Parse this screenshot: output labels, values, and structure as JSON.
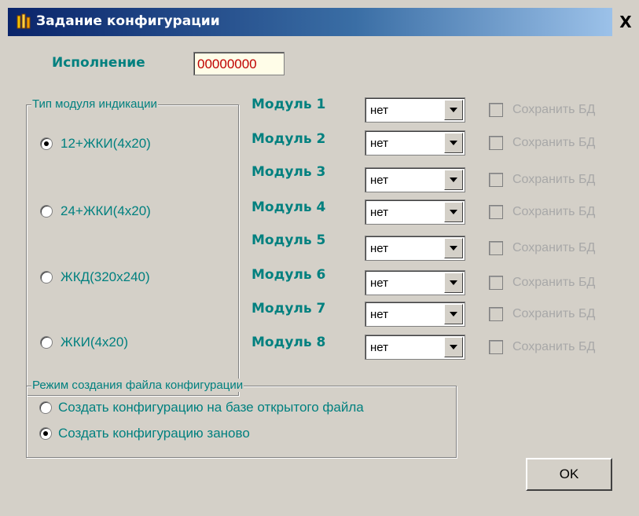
{
  "window": {
    "title": "Задание конфигурации",
    "close_label": "X"
  },
  "ispolnenie": {
    "label": "Исполнение",
    "value": "00000000"
  },
  "indication_group": {
    "caption": "Тип модуля индикации",
    "options": [
      {
        "label": "12+ЖКИ(4x20)",
        "checked": true
      },
      {
        "label": "24+ЖКИ(4x20)",
        "checked": false
      },
      {
        "label": "ЖКД(320x240)",
        "checked": false
      },
      {
        "label": "ЖКИ(4x20)",
        "checked": false
      }
    ]
  },
  "modules": [
    {
      "label": "Модуль 1",
      "value": "нет",
      "save_label": "Сохранить БД",
      "save_checked": false
    },
    {
      "label": "Модуль 2",
      "value": "нет",
      "save_label": "Сохранить БД",
      "save_checked": false
    },
    {
      "label": "Модуль 3",
      "value": "нет",
      "save_label": "Сохранить БД",
      "save_checked": false
    },
    {
      "label": "Модуль 4",
      "value": "нет",
      "save_label": "Сохранить БД",
      "save_checked": false
    },
    {
      "label": "Модуль 5",
      "value": "нет",
      "save_label": "Сохранить БД",
      "save_checked": false
    },
    {
      "label": "Модуль 6",
      "value": "нет",
      "save_label": "Сохранить БД",
      "save_checked": false
    },
    {
      "label": "Модуль 7",
      "value": "нет",
      "save_label": "Сохранить БД",
      "save_checked": false
    },
    {
      "label": "Модуль 8",
      "value": "нет",
      "save_label": "Сохранить БД",
      "save_checked": false
    }
  ],
  "mode_group": {
    "caption": "Режим создания файла конфигурации",
    "options": [
      {
        "label": "Создать конфигурацию на базе открытого файла",
        "checked": false
      },
      {
        "label": "Создать конфигурацию заново",
        "checked": true
      }
    ]
  },
  "ok_label": "OK",
  "colors": {
    "label_teal": "#00807f",
    "value_red": "#c00000",
    "title_bar": "#0a246a",
    "face": "#d4d0c8"
  }
}
